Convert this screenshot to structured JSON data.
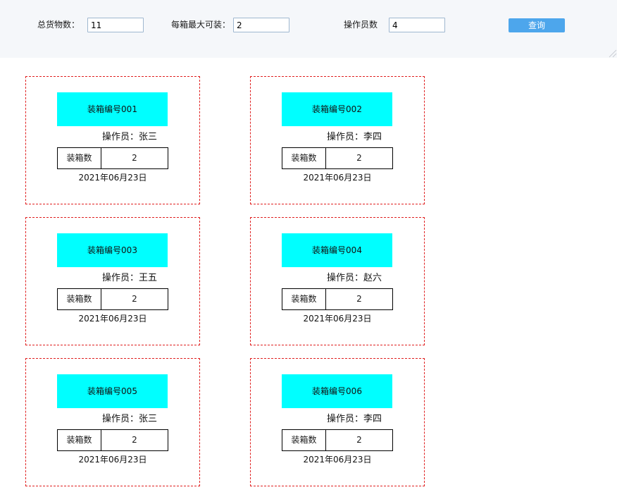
{
  "query": {
    "total_goods_label": "总货物数：",
    "total_goods_value": "11",
    "max_per_box_label": "每箱最大可装：",
    "max_per_box_value": "2",
    "operator_count_label": "操作员数",
    "operator_count_value": "4",
    "search_button_label": "查询"
  },
  "card_labels": {
    "operator_prefix": "操作员：",
    "count_label": "装箱数"
  },
  "cards": [
    {
      "box_title": "装箱编号001",
      "operator": "张三",
      "count": "2",
      "date": "2021年06月23日"
    },
    {
      "box_title": "装箱编号002",
      "operator": "李四",
      "count": "2",
      "date": "2021年06月23日"
    },
    {
      "box_title": "装箱编号003",
      "operator": "王五",
      "count": "2",
      "date": "2021年06月23日"
    },
    {
      "box_title": "装箱编号004",
      "operator": "赵六",
      "count": "2",
      "date": "2021年06月23日"
    },
    {
      "box_title": "装箱编号005",
      "operator": "张三",
      "count": "2",
      "date": "2021年06月23日"
    },
    {
      "box_title": "装箱编号006",
      "operator": "李四",
      "count": "2",
      "date": "2021年06月23日"
    }
  ],
  "colors": {
    "box_title_bg": "#00ffff",
    "card_border": "#e02020",
    "button_bg": "#4da6ec",
    "query_bar_bg": "#f5f7fa"
  }
}
